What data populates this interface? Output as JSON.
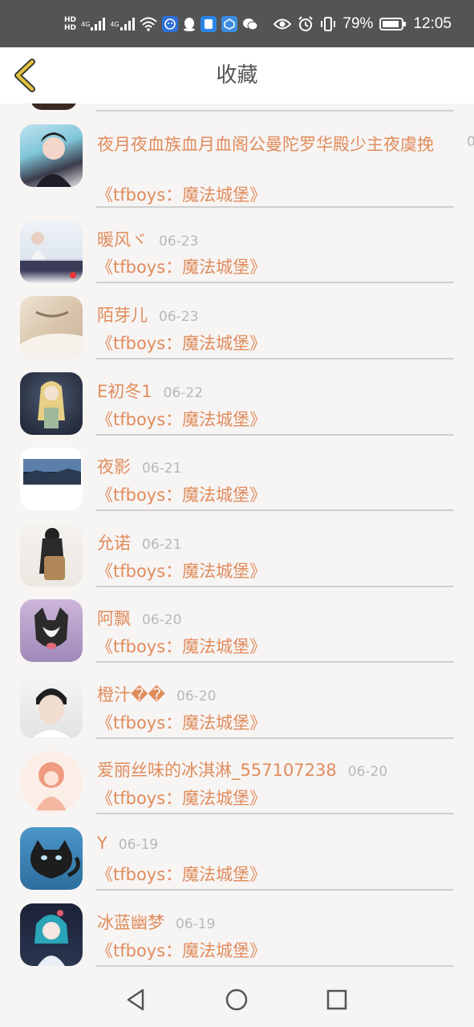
{
  "status_bar": {
    "hd1": "HD",
    "hd2": "HD",
    "net1": "4G",
    "net2": "4G",
    "battery_percent": "79%",
    "time": "12:05"
  },
  "header": {
    "title": "收藏"
  },
  "favorites": [
    {
      "name": "夜月夜血族血月血阁公曼陀罗华殿少主夜虞挽",
      "date": "0",
      "book": "《tfboys：魔法城堡》"
    },
    {
      "name": "暖风ヾ",
      "date": "06-23",
      "book": "《tfboys：魔法城堡》"
    },
    {
      "name": "陌芽儿",
      "date": "06-23",
      "book": "《tfboys：魔法城堡》"
    },
    {
      "name": "E初冬1",
      "date": "06-22",
      "book": "《tfboys：魔法城堡》"
    },
    {
      "name": "夜影",
      "date": "06-21",
      "book": "《tfboys：魔法城堡》"
    },
    {
      "name": "允诺",
      "date": "06-21",
      "book": "《tfboys：魔法城堡》"
    },
    {
      "name": "阿飘",
      "date": "06-20",
      "book": "《tfboys：魔法城堡》"
    },
    {
      "name": "橙汁��",
      "date": "06-20",
      "book": "《tfboys：魔法城堡》"
    },
    {
      "name": "爱丽丝味的冰淇淋_557107238",
      "date": "06-20",
      "book": "《tfboys：魔法城堡》"
    },
    {
      "name": "Y",
      "date": "06-19",
      "book": "《tfboys：魔法城堡》"
    },
    {
      "name": "冰蓝幽梦",
      "date": "06-19",
      "book": "《tfboys：魔法城堡》"
    }
  ],
  "colors": {
    "accent": "#e08c5b",
    "back_arrow": "#e5c33f",
    "status_bar": "#545454"
  }
}
